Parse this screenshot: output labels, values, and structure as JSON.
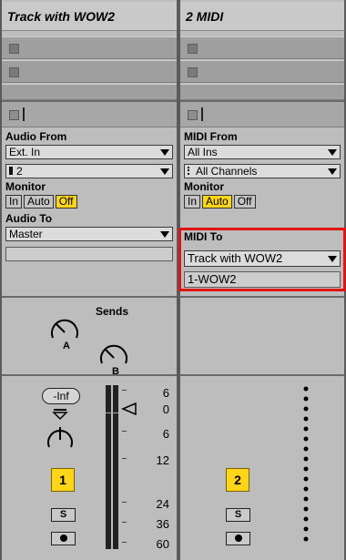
{
  "tracks": [
    {
      "title": "Track with WOW2",
      "io": {
        "from_label": "Audio From",
        "from_value": "Ext. In",
        "from_channel": "2",
        "monitor_label": "Monitor",
        "monitor_options": [
          "In",
          "Auto",
          "Off"
        ],
        "monitor_selected": "Off",
        "to_label": "Audio To",
        "to_value": "Master",
        "to_sub": ""
      },
      "sends_label": "Sends",
      "send_knobs": [
        "A",
        "B"
      ],
      "volume": "-Inf",
      "meter_ticks": [
        "6",
        "0",
        "6",
        "12",
        "24",
        "36",
        "60"
      ],
      "track_number": "1",
      "solo_label": "S"
    },
    {
      "title": "2 MIDI",
      "io": {
        "from_label": "MIDI From",
        "from_value": "All Ins",
        "from_channel": "All Channels",
        "monitor_label": "Monitor",
        "monitor_options": [
          "In",
          "Auto",
          "Off"
        ],
        "monitor_selected": "Auto",
        "to_label": "MIDI To",
        "to_value": "Track with WOW2",
        "to_sub": "1-WOW2"
      },
      "track_number": "2",
      "solo_label": "S"
    }
  ],
  "colors": {
    "accent": "#ffd51a",
    "highlight": "#e01414"
  }
}
